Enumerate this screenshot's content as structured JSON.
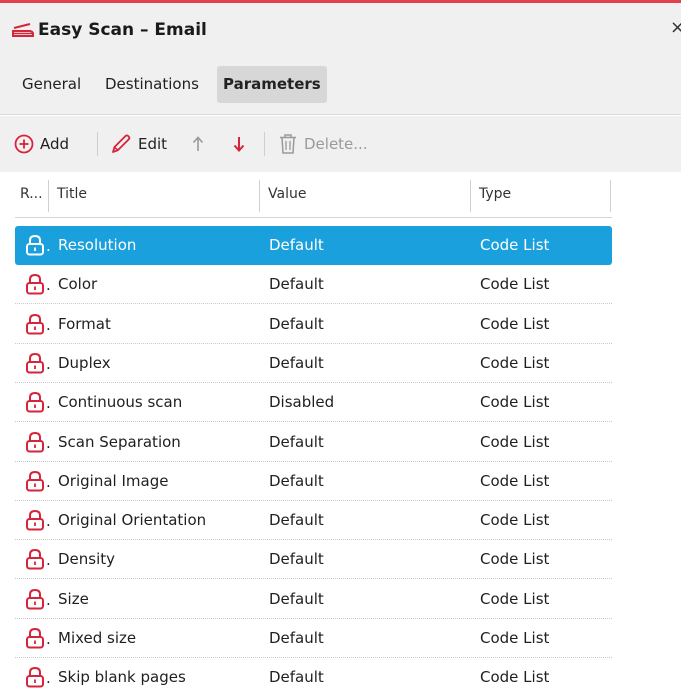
{
  "window": {
    "title": "Easy Scan – Email",
    "close_glyph": "×",
    "accent": "#e4414f"
  },
  "tabs": [
    {
      "label": "General",
      "active": false
    },
    {
      "label": "Destinations",
      "active": false
    },
    {
      "label": "Parameters",
      "active": true
    }
  ],
  "toolbar": {
    "add_label": "Add",
    "edit_label": "Edit",
    "delete_label": "Delete..."
  },
  "columns": {
    "required": "R...",
    "title": "Title",
    "value": "Value",
    "type": "Type"
  },
  "rows": [
    {
      "title": "Resolution",
      "value": "Default",
      "type": "Code List",
      "selected": true
    },
    {
      "title": "Color",
      "value": "Default",
      "type": "Code List"
    },
    {
      "title": "Format",
      "value": "Default",
      "type": "Code List"
    },
    {
      "title": "Duplex",
      "value": "Default",
      "type": "Code List"
    },
    {
      "title": "Continuous scan",
      "value": "Disabled",
      "type": "Code List"
    },
    {
      "title": "Scan Separation",
      "value": "Default",
      "type": "Code List"
    },
    {
      "title": "Original Image",
      "value": "Default",
      "type": "Code List"
    },
    {
      "title": "Original Orientation",
      "value": "Default",
      "type": "Code List"
    },
    {
      "title": "Density",
      "value": "Default",
      "type": "Code List"
    },
    {
      "title": "Size",
      "value": "Default",
      "type": "Code List"
    },
    {
      "title": "Mixed size",
      "value": "Default",
      "type": "Code List"
    },
    {
      "title": "Skip blank pages",
      "value": "Default",
      "type": "Code List"
    }
  ],
  "colors": {
    "selected_row": "#1aa0dc",
    "lock_icon": "#d6243a",
    "toolbar_background": "#f0f0f0"
  }
}
